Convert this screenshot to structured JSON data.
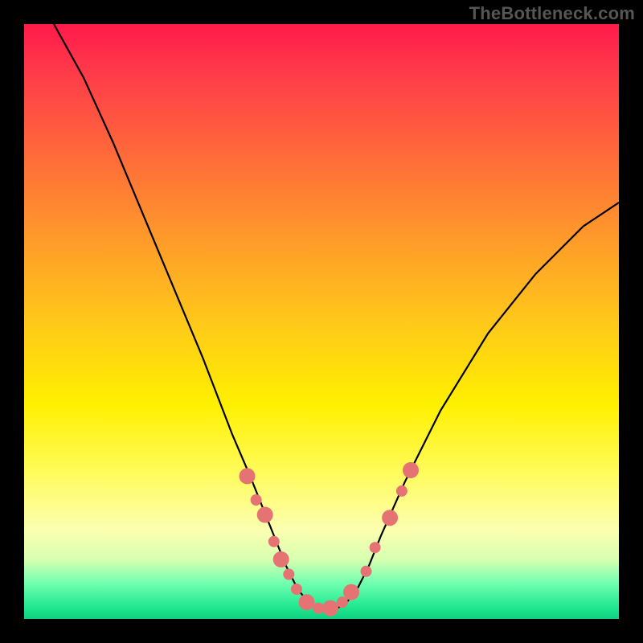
{
  "watermark": "TheBottleneck.com",
  "chart_data": {
    "type": "line",
    "title": "",
    "xlabel": "",
    "ylabel": "",
    "xlim": [
      0,
      100
    ],
    "ylim": [
      0,
      100
    ],
    "background_gradient": {
      "top": "#ff1a4a",
      "middle": "#fff000",
      "bottom": "#10d080"
    },
    "series": [
      {
        "name": "curve",
        "color": "#000000",
        "x": [
          5,
          10,
          15,
          20,
          25,
          30,
          35,
          38,
          40,
          42,
          44,
          46,
          48,
          50,
          52,
          54,
          56,
          58,
          60,
          64,
          70,
          78,
          86,
          94,
          100
        ],
        "y": [
          100,
          91,
          80,
          68,
          56,
          44,
          31,
          24,
          19,
          14,
          9,
          5,
          2.5,
          1.5,
          1.5,
          2.5,
          5,
          9,
          14,
          23,
          35,
          48,
          58,
          66,
          70
        ]
      }
    ],
    "markers": {
      "color": "#e57373",
      "radius_large": 10,
      "radius_small": 7,
      "points": [
        {
          "x": 37.5,
          "y": 24,
          "r": "large"
        },
        {
          "x": 39.0,
          "y": 20,
          "r": "small"
        },
        {
          "x": 40.5,
          "y": 17.5,
          "r": "large"
        },
        {
          "x": 42.0,
          "y": 13,
          "r": "small"
        },
        {
          "x": 43.2,
          "y": 10,
          "r": "large"
        },
        {
          "x": 44.5,
          "y": 7.5,
          "r": "small"
        },
        {
          "x": 45.8,
          "y": 5,
          "r": "small"
        },
        {
          "x": 47.5,
          "y": 2.8,
          "r": "large"
        },
        {
          "x": 49.5,
          "y": 1.8,
          "r": "small"
        },
        {
          "x": 51.5,
          "y": 1.8,
          "r": "large"
        },
        {
          "x": 53.5,
          "y": 2.8,
          "r": "small"
        },
        {
          "x": 55.0,
          "y": 4.5,
          "r": "large"
        },
        {
          "x": 57.5,
          "y": 8,
          "r": "small"
        },
        {
          "x": 59.0,
          "y": 12,
          "r": "small"
        },
        {
          "x": 61.5,
          "y": 17,
          "r": "large"
        },
        {
          "x": 63.5,
          "y": 21.5,
          "r": "small"
        },
        {
          "x": 65.0,
          "y": 25,
          "r": "large"
        }
      ]
    }
  }
}
